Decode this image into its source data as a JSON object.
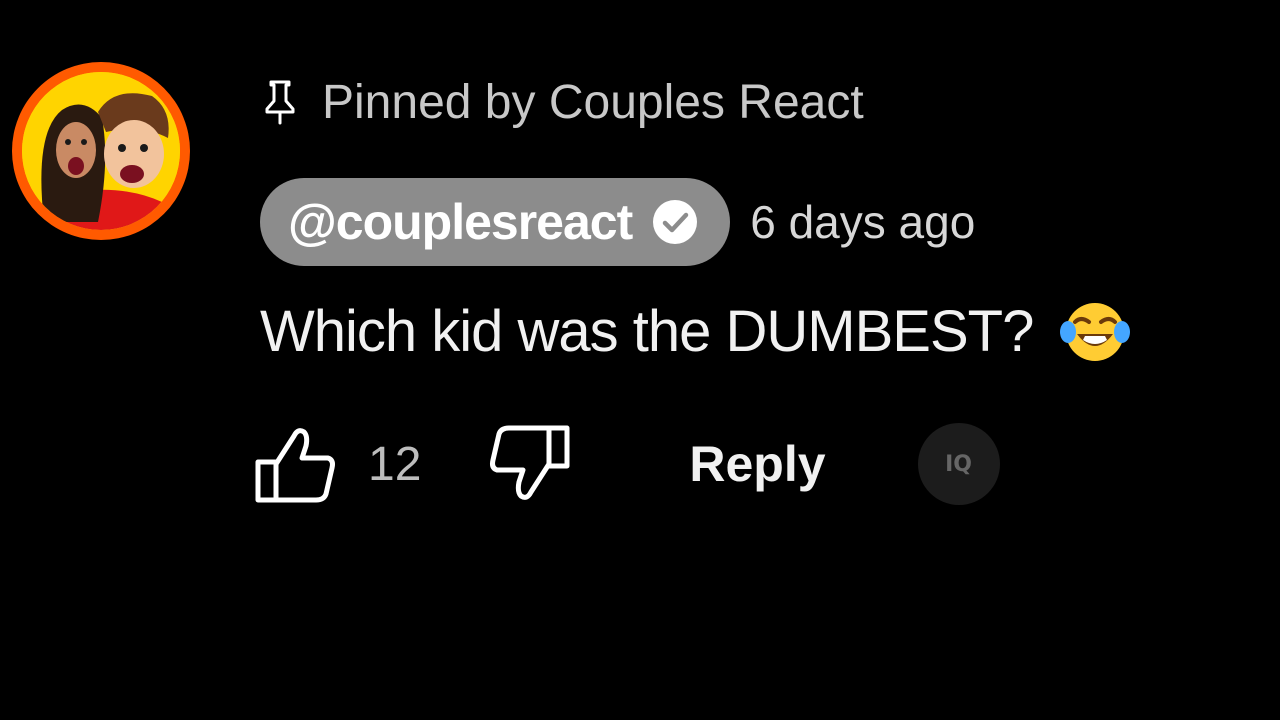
{
  "comment": {
    "pinned_label": "Pinned by Couples React",
    "author_handle": "@couplesreact",
    "timestamp": "6 days ago",
    "text": "Which kid was the DUMBEST?",
    "emoji": "face-with-tears-of-joy",
    "like_count": "12",
    "reply_label": "Reply",
    "extra_button_label": "IQ"
  },
  "icons": {
    "pin": "pin-icon",
    "verified": "verified-checkmark-icon",
    "like": "thumbs-up-icon",
    "dislike": "thumbs-down-icon"
  },
  "colors": {
    "background": "#000000",
    "author_chip": "#8c8c8c",
    "avatar_ring": "#ff5a00",
    "avatar_bg": "#ffd400"
  }
}
